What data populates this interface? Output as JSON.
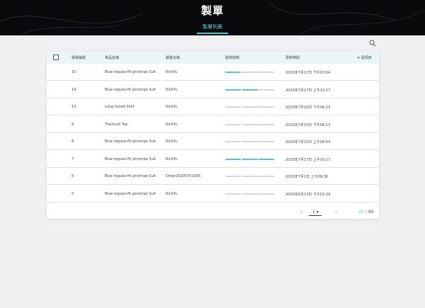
{
  "header": {
    "title": "製單",
    "tab_label": "製單列表"
  },
  "colors": {
    "accent": "#5cc5c8",
    "header_bg": "#0a0a0c",
    "table_header_bg": "#e9f6f5",
    "progress_empty": "#d6d6d6"
  },
  "icons": {
    "search": "search-icon",
    "checkbox": "checkbox-icon",
    "prev": "chevron-left-icon",
    "next": "chevron-right-icon",
    "dropdown": "caret-down-icon"
  },
  "table": {
    "columns": {
      "id": "製單編號",
      "product": "單品名稱",
      "customer": "顧客名稱",
      "status": "製單狀態",
      "updated": "更新時間",
      "settings": "≡ 個項目"
    },
    "rows": [
      {
        "id": "15",
        "product": "Blue regular-fit pinstripe Suit",
        "customer": "RickYu",
        "progress": 1,
        "updated": "2020年7月17日 下午03:04"
      },
      {
        "id": "14",
        "product": "Blue regular-fit pinstripe Suit",
        "customer": "RickYu",
        "progress": 2,
        "updated": "2020年7月17日 上午10:17"
      },
      {
        "id": "13",
        "product": "Long Gored Skirt",
        "customer": "RickYu",
        "progress": 0,
        "updated": "2020年7月16日 下午06:23"
      },
      {
        "id": "9",
        "product": "Tracksuit Top",
        "customer": "RickYu",
        "progress": 0,
        "updated": "2020年7月15日 下午06:13"
      },
      {
        "id": "8",
        "product": "Blue regular-fit pinstripe Suit",
        "customer": "RickYu",
        "progress": 0,
        "updated": "2020年7月15日 上午09:54"
      },
      {
        "id": "7",
        "product": "Blue regular-fit pinstripe Suit",
        "customer": "RickYu",
        "progress": 3,
        "updated": "2020年7月17日 上午10:17"
      },
      {
        "id": "6",
        "product": "Blue regular-fit pinstripe Suit",
        "customer": "Order20200701005",
        "progress": 0,
        "updated": "2020年7月1日 上午09:36"
      },
      {
        "id": "5",
        "product": "Blue regular-fit pinstripe Suit",
        "customer": "RickYu",
        "progress": 0,
        "updated": "2020年6月23日 下午02:29"
      }
    ]
  },
  "pagination": {
    "prev": "‹",
    "next": "›",
    "page": "1 ▾",
    "per_page": "40",
    "separator": "|",
    "total": "80"
  }
}
